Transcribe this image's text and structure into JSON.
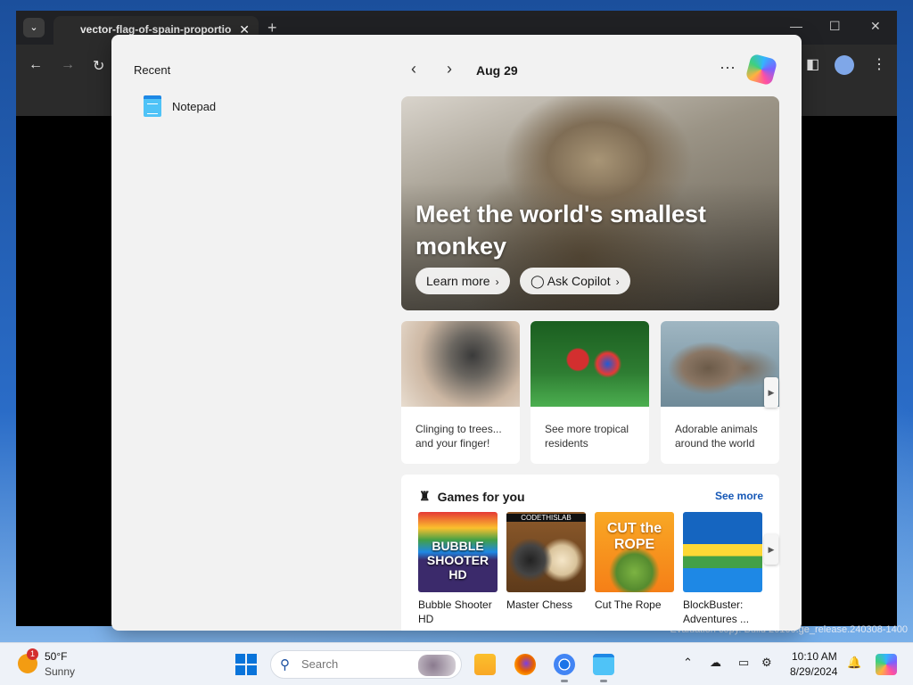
{
  "browser": {
    "tab_title": "vector-flag-of-spain-proportio",
    "tab_close": "✕",
    "new_tab": "+",
    "back_icon": "←",
    "forward_icon": "→",
    "reload_icon": "↻",
    "menu_icon": "⋮"
  },
  "start_panel": {
    "recent_title": "Recent",
    "recent_items": [
      {
        "label": "Notepad",
        "icon": "notepad-icon"
      }
    ],
    "date": "Aug 29",
    "more_icon": "···",
    "hero": {
      "title": "Meet the world's smallest monkey",
      "learn_more": "Learn more",
      "ask_copilot": "Ask Copilot"
    },
    "cards": [
      {
        "text": "Clinging to trees... and your finger!"
      },
      {
        "text": "See more tropical residents"
      },
      {
        "text": "Adorable animals around the world"
      }
    ],
    "games": {
      "title": "Games for you",
      "see_more": "See more",
      "items": [
        {
          "name": "Bubble Shooter HD",
          "art_text": "BUBBLE SHOOTER HD"
        },
        {
          "name": "Master Chess",
          "art_text": "CODETHISLAB"
        },
        {
          "name": "Cut The Rope",
          "art_text": "CUT the ROPE"
        },
        {
          "name": "BlockBuster: Adventures ...",
          "art_text": ""
        }
      ]
    }
  },
  "watermark": "Evaluation copy. Build 26100.ge_release.240308-1400",
  "taskbar": {
    "weather_badge": "1",
    "temperature": "50°F",
    "condition": "Sunny",
    "search_placeholder": "Search",
    "time": "10:10 AM",
    "date": "8/29/2024"
  }
}
